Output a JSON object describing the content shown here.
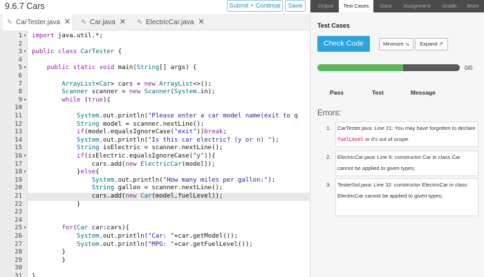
{
  "editor": {
    "title": "9.6.7 Cars",
    "submit_label": "Submit + Continue",
    "save_label": "Save",
    "tabs": [
      {
        "label": "CarTester.java",
        "active": true
      },
      {
        "label": "Car.java",
        "active": false
      },
      {
        "label": "ElectricCar.java",
        "active": false
      }
    ],
    "line_numbers": [
      "1",
      "2",
      "3",
      "4",
      "5",
      "6",
      "7",
      "8",
      "9",
      "10",
      "11",
      "12",
      "13",
      "14",
      "15",
      "16",
      "17",
      "18",
      "19",
      "20",
      "21",
      "22",
      "23",
      "24",
      "25",
      "26",
      "27",
      "28",
      "29",
      "30",
      "31"
    ],
    "lines": [
      "import java.util.*;",
      "",
      "public class CarTester {",
      "",
      "    public static void main(String[] args) {",
      "",
      "        ArrayList<Car> cars = new ArrayList<>();",
      "        Scanner scanner = new Scanner(System.in);",
      "        while (true){",
      "",
      "            System.out.println(\"Please enter a car model name(exit to q",
      "            String model = scanner.nextLine();",
      "            if(model.equalsIgnoreCase(\"exit\"))break;",
      "            System.out.println(\"Is this car electric? (y or n) \");",
      "            String isElectric = scanner.nextLine();",
      "            if(isElectric.equalsIgnoreCase(\"y\")){",
      "                cars.add(new ElectricCar(model));",
      "            }else{",
      "                System.out.println(\"How many miles per gallon:\");",
      "                String gallon = scanner.nextLine();",
      "                cars.add(new Car(model,fuelLevel));",
      "            }",
      "",
      "",
      "        for(Car car:cars){",
      "            System.out.println(\"Car: \"+car.getModel());",
      "            System.out.println(\"MPG: \"+car.getFuelLevel());",
      "        }",
      "        }",
      "",
      "}"
    ]
  },
  "panel": {
    "tabs": [
      "Output",
      "Test Cases",
      "Docs",
      "Assignment",
      "Grade",
      "More"
    ],
    "active_tab": "Test Cases",
    "section_title": "Test Cases",
    "check_label": "Check Code",
    "minimize_label": "Minimize",
    "expand_label": "Expand",
    "progress_fraction": 0.6,
    "progress_text": "0/0",
    "table_headers": {
      "pass": "Pass",
      "test": "Test",
      "message": "Message"
    },
    "errors_label": "Errors:",
    "errors": [
      {
        "num": "1.",
        "pre": "CarTester.java: Line 21: You may have forgotten to declare ",
        "code": "fuelLevel",
        "post": " or it's out of scope."
      },
      {
        "num": "2.",
        "pre": "ElectricCar.java: Line 6: constructor Car in class Car cannot be applied to given types;",
        "code": "",
        "post": ""
      },
      {
        "num": "3.",
        "pre": "TesterSol.java: Line 32: constructor ElectricCar in class ElectricCar cannot be applied to given types;",
        "code": "",
        "post": ""
      }
    ]
  },
  "colors": {
    "accent": "#2ba5dc",
    "progress_green": "#5cb85c",
    "keyword": "#8b1d9e",
    "type": "#006a87",
    "string": "#1a1aa6"
  }
}
